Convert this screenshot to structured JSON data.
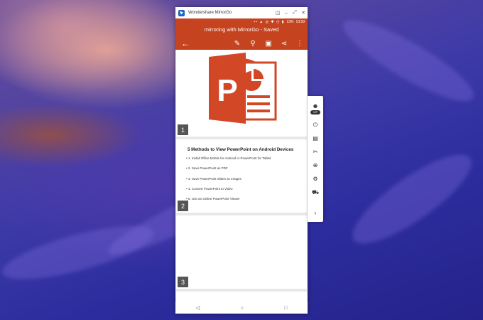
{
  "window": {
    "title": "Wondershare MirrorGo",
    "controls": [
      "pin-icon",
      "minimize-icon",
      "maximize-icon",
      "close-icon"
    ]
  },
  "phone": {
    "status_icons": "▪▪ ▲ ◎ ✱ ◷ ▮",
    "battery": "13%",
    "time": "13:59",
    "doc_title": "mirroring with MirrorGo - Saved",
    "toolbar_icons": [
      "back-arrow-icon",
      "pencil-icon",
      "search-icon",
      "present-icon",
      "share-icon",
      "more-icon"
    ],
    "accent_color": "#c6431f"
  },
  "slides": [
    {
      "number": "1",
      "logo_letter": "P"
    },
    {
      "number": "2",
      "heading": "5 Methods to View PowerPoint on Android Devices",
      "items": [
        "• 1. Install Office Mobile for Android or PowerPoint for Tablet",
        "• 2. Save PowerPoint as PDF",
        "• 3. Save PowerPoint Slides as Images",
        "• 4. Convert PowerPoint to Video",
        "• 5. Use an Online PowerPoint Viewer"
      ]
    },
    {
      "number": "3"
    }
  ],
  "side_panel": {
    "vip_label": "VIP",
    "icons": [
      "avatar-icon",
      "power-icon",
      "file-icon",
      "scissors-icon",
      "record-icon",
      "settings-icon",
      "cart-icon",
      "collapse-icon"
    ]
  },
  "navbar_icons": [
    "nav-back-icon",
    "nav-home-icon",
    "nav-recent-icon"
  ]
}
